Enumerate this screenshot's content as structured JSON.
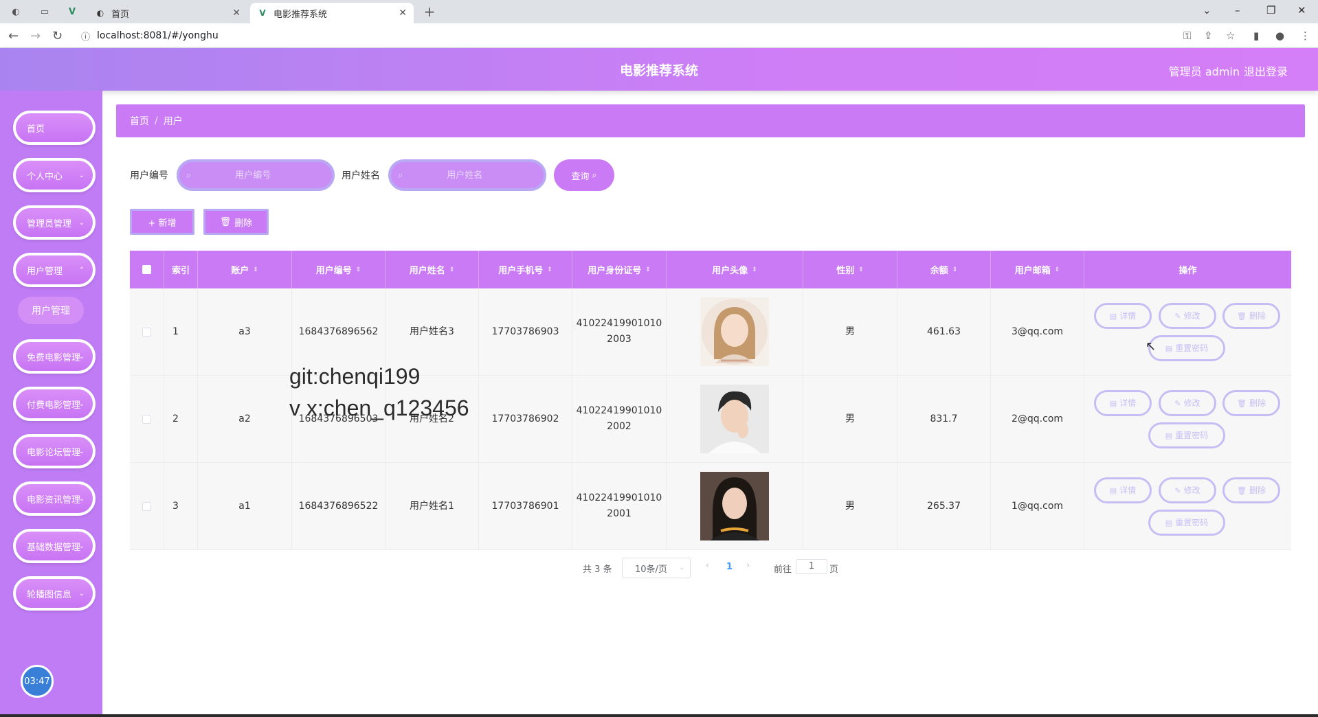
{
  "browser": {
    "tabs": [
      {
        "label": "首页"
      },
      {
        "label": "电影推荐系统"
      }
    ],
    "url": "localhost:8081/#/yonghu",
    "new_tab": "+"
  },
  "header": {
    "title": "电影推荐系统",
    "user": "管理员 admin",
    "logout": "退出登录"
  },
  "sidebar": {
    "items": [
      {
        "label": "首页",
        "chevron": false
      },
      {
        "label": "个人中心",
        "chevron": true
      },
      {
        "label": "管理员管理",
        "chevron": true
      },
      {
        "label": "用户管理",
        "chevron": true
      },
      {
        "label": "免费电影管理",
        "chevron": true
      },
      {
        "label": "付费电影管理",
        "chevron": true
      },
      {
        "label": "电影论坛管理",
        "chevron": true
      },
      {
        "label": "电影资讯管理",
        "chevron": true
      },
      {
        "label": "基础数据管理",
        "chevron": true
      },
      {
        "label": "轮播图信息",
        "chevron": true
      }
    ],
    "sub_item": "用户管理",
    "clock": "03:47"
  },
  "breadcrumb": {
    "home": "首页",
    "current": "用户"
  },
  "search": {
    "label_no": "用户编号",
    "placeholder_no": "用户编号",
    "label_name": "用户姓名",
    "placeholder_name": "用户姓名",
    "query": "查询"
  },
  "actions": {
    "add": "+ 新增",
    "delete": "删除"
  },
  "table": {
    "headers": [
      "索引",
      "账户",
      "用户编号",
      "用户姓名",
      "用户手机号",
      "用户身份证号",
      "用户头像",
      "性别",
      "余额",
      "用户邮箱",
      "操作"
    ],
    "rows": [
      {
        "index": "1",
        "account": "a3",
        "no": "1684376896562",
        "name": "用户姓名3",
        "phone": "17703786903",
        "id1": "41022419901010",
        "id2": "2003",
        "gender": "男",
        "balance": "461.63",
        "email": "3@qq.com"
      },
      {
        "index": "2",
        "account": "a2",
        "no": "1684376896503",
        "name": "用户姓名2",
        "phone": "17703786902",
        "id1": "41022419901010",
        "id2": "2002",
        "gender": "男",
        "balance": "831.7",
        "email": "2@qq.com"
      },
      {
        "index": "3",
        "account": "a1",
        "no": "1684376896522",
        "name": "用户姓名1",
        "phone": "17703786901",
        "id1": "41022419901010",
        "id2": "2001",
        "gender": "男",
        "balance": "265.37",
        "email": "1@qq.com"
      }
    ],
    "ops": {
      "detail": "详情",
      "edit": "修改",
      "delete": "删除",
      "reset": "重置密码"
    }
  },
  "watermark": {
    "line1": "git:chenqi199",
    "line2": "v x:chen_q123456"
  },
  "pagination": {
    "total": "共 3 条",
    "page_size": "10条/页",
    "current": "1",
    "goto": "前往",
    "goto_value": "1",
    "page_unit": "页"
  },
  "colors": {
    "primary": "#c97af4",
    "header_start": "#a984f0",
    "op_border": "#c6bdf5"
  }
}
